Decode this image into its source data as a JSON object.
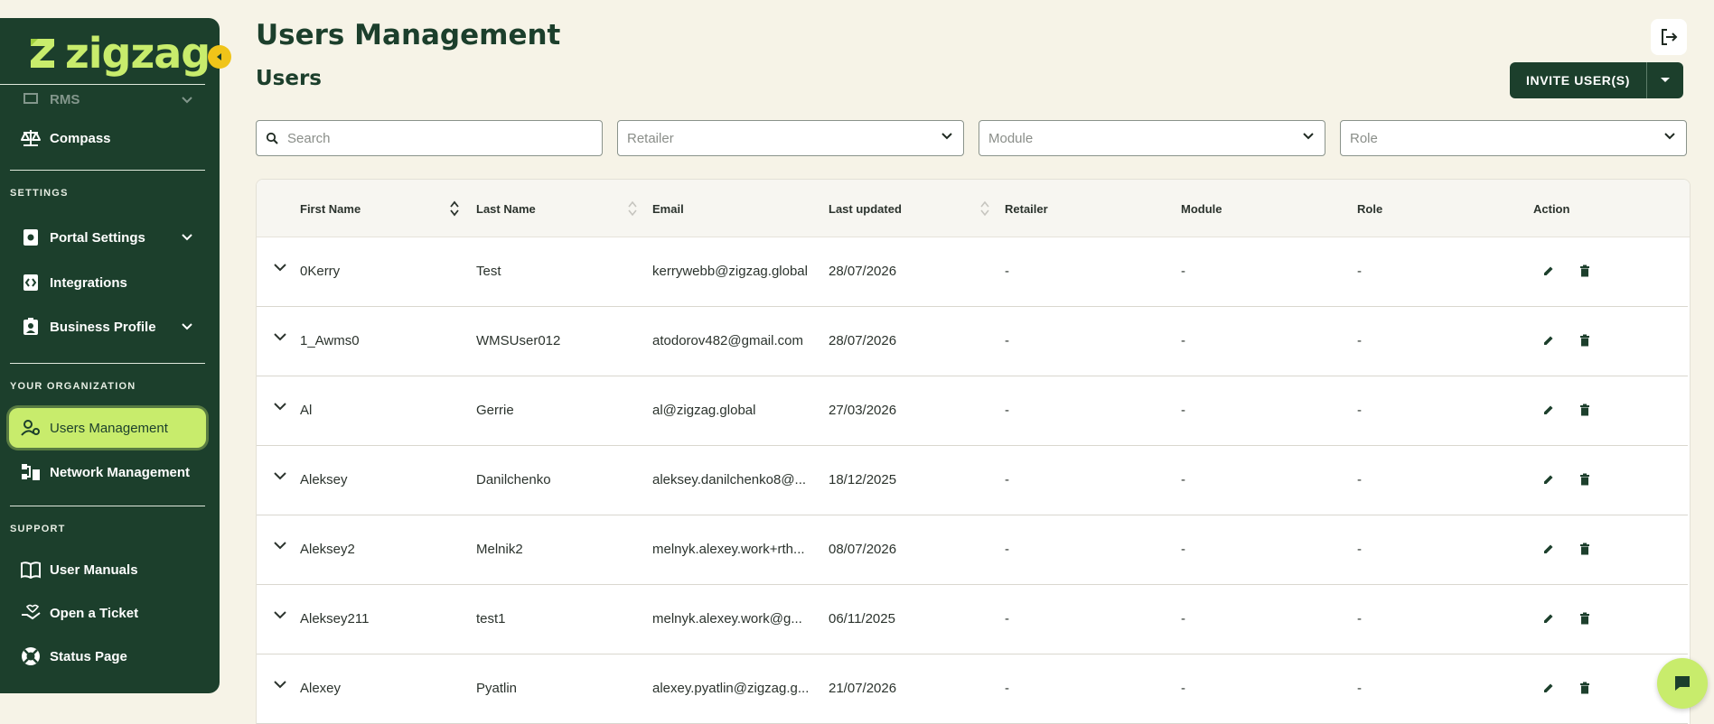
{
  "brand": {
    "name": "zigzag",
    "accent": "#c8ec6c",
    "dark": "#1c3f2c"
  },
  "sidebar": {
    "partial_item": "RMS",
    "compass": "Compass",
    "settings_label": "SETTINGS",
    "portal_settings": "Portal Settings",
    "integrations": "Integrations",
    "business_profile": "Business Profile",
    "org_label": "YOUR ORGANIZATION",
    "users_management": "Users Management",
    "network_management": "Network Management",
    "support_label": "SUPPORT",
    "user_manuals": "User Manuals",
    "open_ticket": "Open a Ticket",
    "status_page": "Status Page"
  },
  "header": {
    "title": "Users Management",
    "subtitle": "Users",
    "invite_label": "INVITE USER(S)"
  },
  "filters": {
    "search_placeholder": "Search",
    "retailer": "Retailer",
    "module": "Module",
    "role": "Role"
  },
  "table": {
    "columns": {
      "first_name": "First Name",
      "last_name": "Last Name",
      "email": "Email",
      "last_updated": "Last updated",
      "retailer": "Retailer",
      "module": "Module",
      "role": "Role",
      "action": "Action"
    },
    "rows": [
      {
        "first": "0Kerry",
        "last": "Test",
        "email": "kerrywebb@zigzag.global",
        "updated": "28/07/2026",
        "retailer": "-",
        "module": "-",
        "role": "-"
      },
      {
        "first": "1_Awms0",
        "last": "WMSUser012",
        "email": "atodorov482@gmail.com",
        "updated": "28/07/2026",
        "retailer": "-",
        "module": "-",
        "role": "-"
      },
      {
        "first": "Al",
        "last": "Gerrie",
        "email": "al@zigzag.global",
        "updated": "27/03/2026",
        "retailer": "-",
        "module": "-",
        "role": "-"
      },
      {
        "first": "Aleksey",
        "last": "Danilchenko",
        "email": "aleksey.danilchenko8@...",
        "updated": "18/12/2025",
        "retailer": "-",
        "module": "-",
        "role": "-"
      },
      {
        "first": "Aleksey2",
        "last": "Melnik2",
        "email": "melnyk.alexey.work+rth...",
        "updated": "08/07/2026",
        "retailer": "-",
        "module": "-",
        "role": "-"
      },
      {
        "first": "Aleksey211",
        "last": "test1",
        "email": "melnyk.alexey.work@g...",
        "updated": "06/11/2025",
        "retailer": "-",
        "module": "-",
        "role": "-"
      },
      {
        "first": "Alexey",
        "last": "Pyatlin",
        "email": "alexey.pyatlin@zigzag.g...",
        "updated": "21/07/2026",
        "retailer": "-",
        "module": "-",
        "role": "-"
      }
    ]
  }
}
